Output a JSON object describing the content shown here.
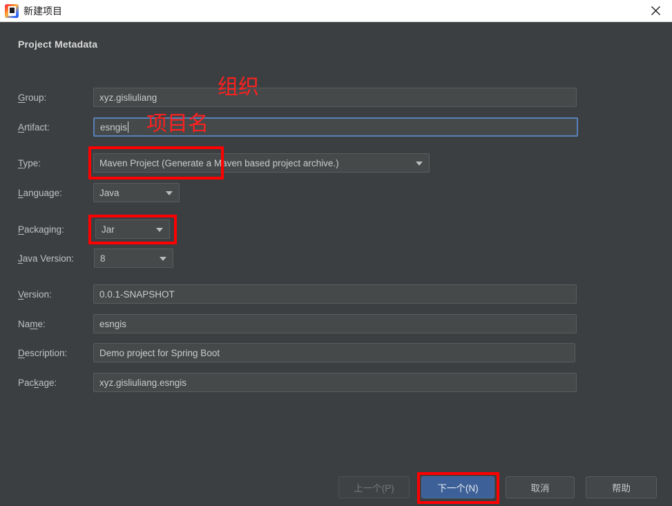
{
  "titlebar": {
    "title": "新建项目",
    "icon": "intellij-idea-icon",
    "close_label": "×"
  },
  "dialog": {
    "section_title": "Project Metadata",
    "fields": [
      {
        "label": "Group:",
        "mnemonic": "G",
        "value": "xyz.gisliuliang",
        "kind": "text"
      },
      {
        "label": "Artifact:",
        "mnemonic": "A",
        "value": "esngis",
        "kind": "text"
      },
      {
        "label": "Type:",
        "mnemonic": "T",
        "value": "Maven Project (Generate a Maven based project archive.)",
        "kind": "dropdown"
      },
      {
        "label": "Language:",
        "mnemonic": "L",
        "value": "Java",
        "kind": "dropdown"
      },
      {
        "label": "Packaging:",
        "mnemonic": "P",
        "value": "Jar",
        "kind": "dropdown"
      },
      {
        "label": "Java Version:",
        "mnemonic": "J",
        "value": "8",
        "kind": "dropdown"
      },
      {
        "label": "Version:",
        "mnemonic": "V",
        "value": "0.0.1-SNAPSHOT",
        "kind": "text"
      },
      {
        "label": "Name:",
        "mnemonic": "m",
        "value": "esngis",
        "kind": "text"
      },
      {
        "label": "Description:",
        "mnemonic": "D",
        "value": "Demo project for Spring Boot",
        "kind": "text"
      },
      {
        "label": "Package:",
        "mnemonic": "k",
        "value": "xyz.gisliuliang.esngis",
        "kind": "text"
      }
    ]
  },
  "annotations": {
    "color": "#fe0000",
    "notes": [
      {
        "text": "组织",
        "target": "group-field"
      },
      {
        "text": "项目名",
        "target": "artifact-field"
      }
    ],
    "boxes": [
      {
        "target": "type-dropdown"
      },
      {
        "target": "packaging-dropdown"
      },
      {
        "target": "next-button"
      }
    ]
  },
  "footer": {
    "buttons": [
      {
        "label": "上一个(P)",
        "state": "disabled"
      },
      {
        "label": "下一个(N)",
        "state": "primary"
      },
      {
        "label": "取消",
        "state": "normal"
      },
      {
        "label": "帮助",
        "state": "normal"
      }
    ]
  }
}
